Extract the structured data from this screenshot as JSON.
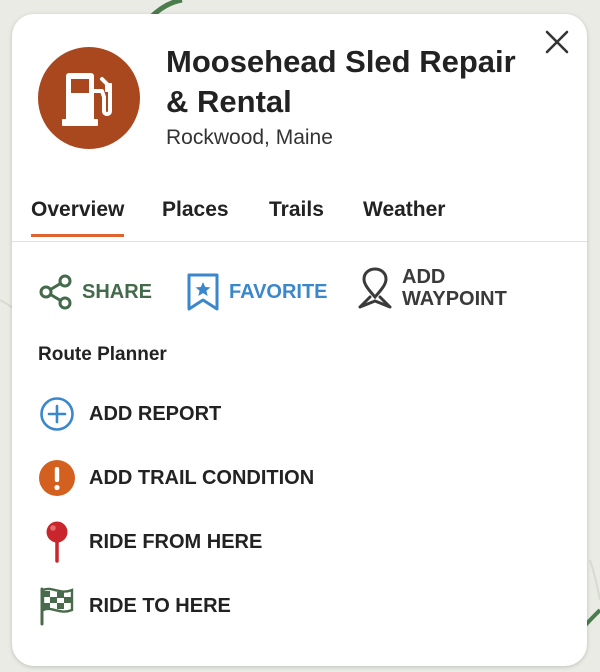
{
  "place": {
    "title": "Moosehead Sled Repair & Rental",
    "location": "Rockwood, Maine",
    "icon": "fuel-pump-icon",
    "icon_bg": "#a9471f"
  },
  "tabs": [
    {
      "label": "Overview",
      "active": true
    },
    {
      "label": "Places",
      "active": false
    },
    {
      "label": "Trails",
      "active": false
    },
    {
      "label": "Weather",
      "active": false
    }
  ],
  "actions": {
    "share": {
      "label": "SHARE",
      "icon": "share-icon",
      "color": "#436a4a"
    },
    "favorite": {
      "label": "FAVORITE",
      "icon": "bookmark-star-icon",
      "color": "#3a87cc"
    },
    "waypoint": {
      "label_line1": "ADD",
      "label_line2": "WAYPOINT",
      "icon": "map-pin-icon",
      "color": "#3a3a3a"
    }
  },
  "route_planner": {
    "title": "Route Planner",
    "items": [
      {
        "label": "ADD REPORT",
        "icon": "plus-circle-icon",
        "color": "#3a87cc"
      },
      {
        "label": "ADD TRAIL CONDITION",
        "icon": "exclamation-circle-icon",
        "color": "#d3601f"
      },
      {
        "label": "RIDE FROM HERE",
        "icon": "red-pin-icon",
        "color": "#c8262c"
      },
      {
        "label": "RIDE TO HERE",
        "icon": "checkered-flag-icon",
        "color": "#4a6b4b"
      }
    ]
  },
  "accent_color": "#e0622e"
}
